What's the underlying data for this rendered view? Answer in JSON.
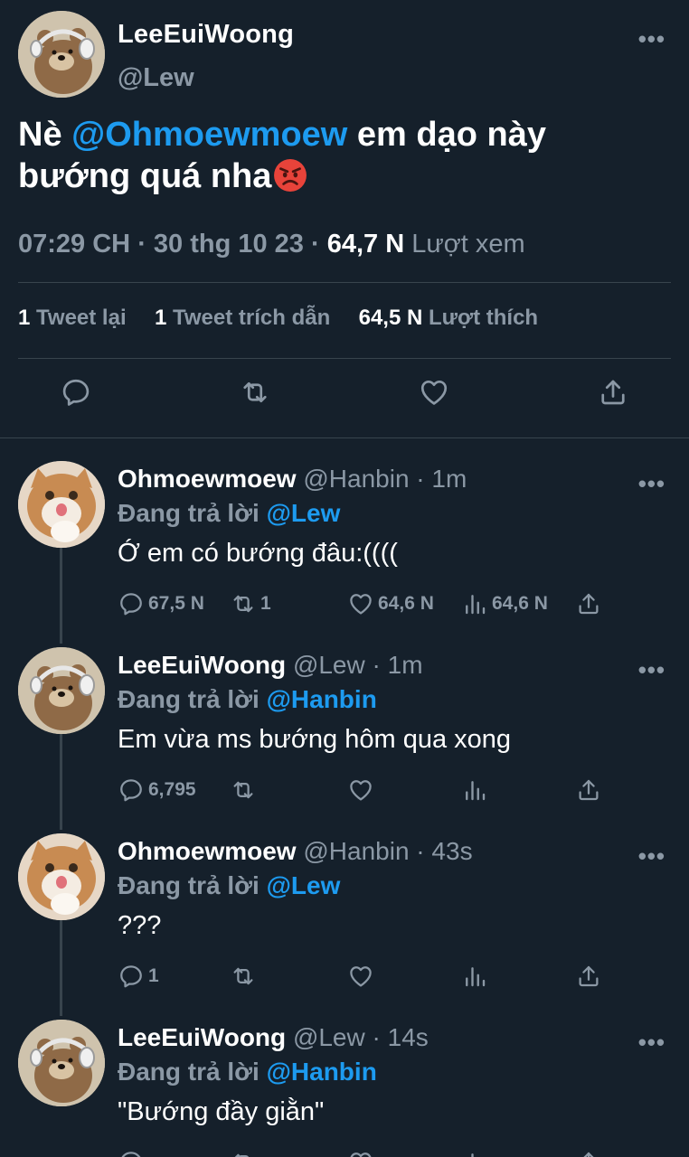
{
  "main_tweet": {
    "name": "LeeEuiWoong",
    "handle": "@Lew",
    "text_before": "Nè ",
    "mention": "@Ohmoewmoew",
    "text_after": " em dạo này bướng quá nha",
    "time": "07:29 CH",
    "date": "30 thg 10 23",
    "views_count": "64,7 N",
    "views_label": "Lượt xem",
    "retweets_count": "1",
    "retweets_label": "Tweet lại",
    "quotes_count": "1",
    "quotes_label": "Tweet trích dẫn",
    "likes_count": "64,5 N",
    "likes_label": "Lượt thích"
  },
  "replies": [
    {
      "name": "Ohmoewmoew",
      "handle": "@Hanbin",
      "time": "1m",
      "replying_prefix": "Đang trả lời ",
      "replying_to": "@Lew",
      "text": "Ớ em có bướng đâu:((((",
      "reply_count": "67,5 N",
      "retweet_count": "1",
      "like_count": "64,6 N",
      "view_count": "64,6 N"
    },
    {
      "name": "LeeEuiWoong",
      "handle": "@Lew",
      "time": "1m",
      "replying_prefix": "Đang trả lời ",
      "replying_to": "@Hanbin",
      "text": "Em vừa ms bướng hôm qua xong",
      "reply_count": "6,795",
      "retweet_count": "",
      "like_count": "",
      "view_count": ""
    },
    {
      "name": "Ohmoewmoew",
      "handle": "@Hanbin",
      "time": "43s",
      "replying_prefix": "Đang trả lời ",
      "replying_to": "@Lew",
      "text": "???",
      "reply_count": "1",
      "retweet_count": "",
      "like_count": "",
      "view_count": ""
    },
    {
      "name": "LeeEuiWoong",
      "handle": "@Lew",
      "time": "14s",
      "replying_prefix": "Đang trả lời ",
      "replying_to": "@Hanbin",
      "text": "\"Bướng đầy giằn\"",
      "reply_count": "",
      "retweet_count": "",
      "like_count": "",
      "view_count": ""
    }
  ],
  "colors": {
    "background": "#15202b",
    "accent": "#1d9bf0",
    "muted": "#8b98a5",
    "divider": "#38444d"
  },
  "icons": [
    "more-icon",
    "reply-icon",
    "retweet-icon",
    "like-icon",
    "views-icon",
    "share-icon",
    "angry-face-emoji"
  ]
}
